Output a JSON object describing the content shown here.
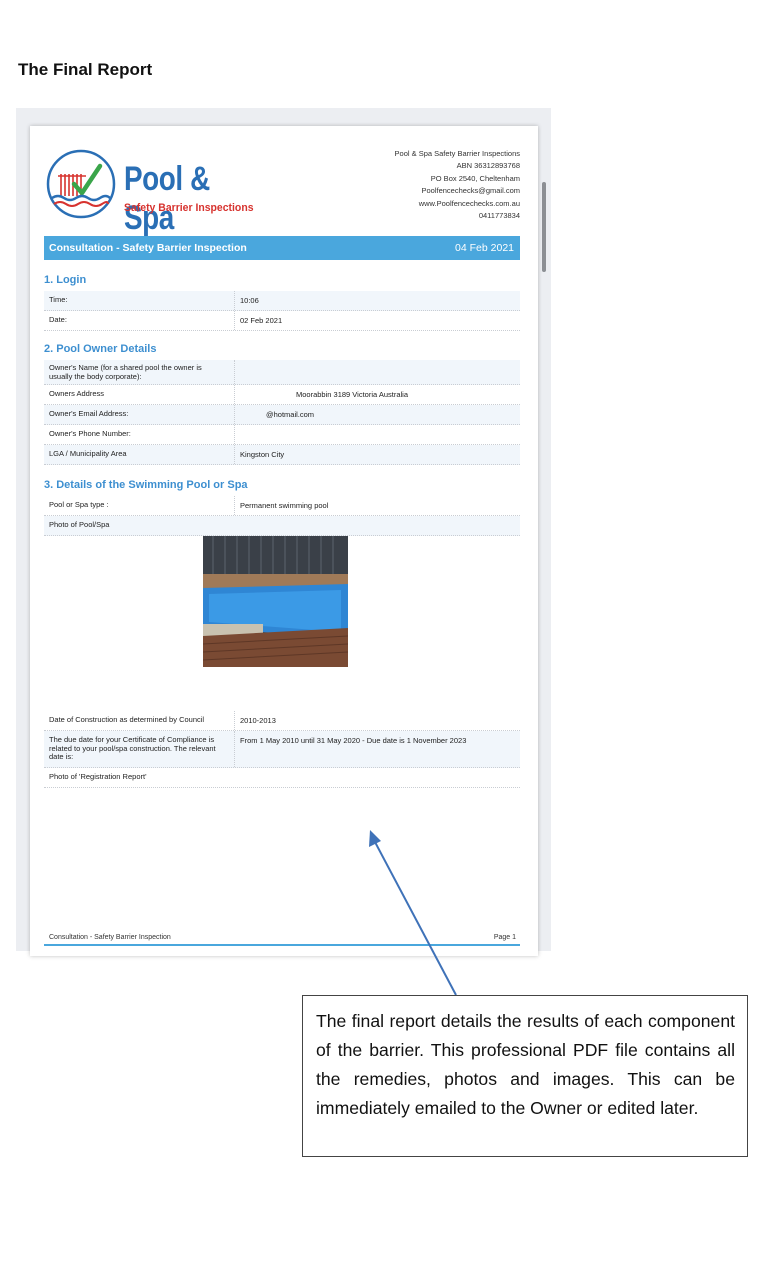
{
  "heading": "The Final Report",
  "header": {
    "logo_main": "Pool & Spa",
    "logo_sub": "Safety Barrier Inspections",
    "contact": [
      "Pool & Spa Safety Barrier Inspections",
      "ABN 36312893768",
      "PO Box 2540, Cheltenham",
      "Poolfencechecks@gmail.com",
      "www.Poolfencechecks.com.au",
      "0411773834"
    ]
  },
  "banner": {
    "title": "Consultation - Safety Barrier Inspection",
    "date": "04 Feb 2021"
  },
  "sections": {
    "login": {
      "title": "1. Login",
      "rows": [
        {
          "label": "Time:",
          "value": "10:06"
        },
        {
          "label": "Date:",
          "value": "02 Feb 2021"
        }
      ]
    },
    "owner": {
      "title": "2. Pool Owner Details",
      "rows": [
        {
          "label": "Owner's Name (for a shared pool the owner is usually the body corporate):",
          "value": ""
        },
        {
          "label": "Owners Address",
          "value": "Moorabbin 3189 Victoria Australia"
        },
        {
          "label": "Owner's Email Address:",
          "value": "@hotmail.com"
        },
        {
          "label": "Owner's Phone Number:",
          "value": ""
        },
        {
          "label": "LGA / Municipality Area",
          "value": "Kingston City"
        }
      ]
    },
    "pool": {
      "title": "3. Details of the Swimming Pool or Spa",
      "rows": [
        {
          "label": "Pool or Spa type :",
          "value": "Permanent swimming pool"
        },
        {
          "label": "Photo of Pool/Spa",
          "value": ""
        },
        {
          "label": "Date of Construction as determined by Council",
          "value": "2010-2013"
        },
        {
          "label": "The due date for your Certificate of Compliance is related to your pool/spa construction. The relevant date is:",
          "value": "From 1 May 2010 until 31 May 2020 - Due date is 1 November 2023"
        },
        {
          "label": "Photo of 'Registration Report'",
          "value": ""
        }
      ]
    }
  },
  "footer": {
    "left": "Consultation - Safety Barrier Inspection",
    "right": "Page 1"
  },
  "callout": "The final report details the results of each component of the barrier.  This professional PDF file contains all the remedies, photos and images.  This can be immediately emailed to the Owner or edited later.",
  "colors": {
    "accent_blue": "#4aa7dd",
    "section_blue": "#3d8fd0",
    "logo_red": "#d7332f"
  }
}
